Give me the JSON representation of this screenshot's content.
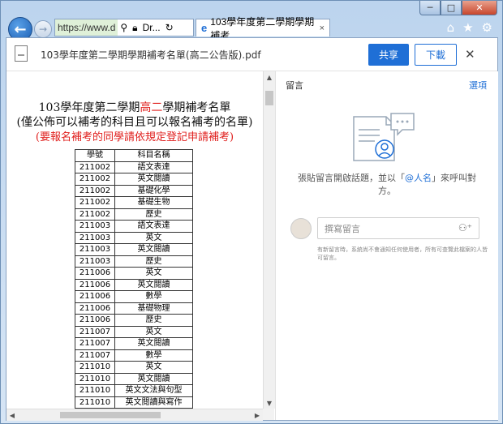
{
  "browser": {
    "address_url": "https://www.d",
    "address_search_icon": "search-icon",
    "address_tab2": "Dr...",
    "tab_title": "103學年度第二學期學期補考...",
    "tab_close": "×"
  },
  "window_controls": {
    "minimize": "─",
    "maximize": "□",
    "close": "✕"
  },
  "viewer": {
    "file_title": "103學年度第二學期學期補考名單(高二公告版).pdf",
    "share_label": "共享",
    "download_label": "下載",
    "close_label": "✕"
  },
  "document": {
    "title_prefix": "103學年度第二學期",
    "title_red": "高二",
    "title_suffix": "學期補考名單",
    "subtitle": "(僅公佈可以補考的科目且可以報名補考的名單)",
    "notice": "(要報名補考的同學請依規定登記申請補考)",
    "table_headers": [
      "學號",
      "科目名稱"
    ],
    "rows": [
      [
        "211002",
        "語文表達"
      ],
      [
        "211002",
        "英文閱讀"
      ],
      [
        "211002",
        "基礎化學"
      ],
      [
        "211002",
        "基礎生物"
      ],
      [
        "211002",
        "歷史"
      ],
      [
        "211003",
        "語文表達"
      ],
      [
        "211003",
        "英文"
      ],
      [
        "211003",
        "英文閱讀"
      ],
      [
        "211003",
        "歷史"
      ],
      [
        "211006",
        "英文"
      ],
      [
        "211006",
        "英文閱讀"
      ],
      [
        "211006",
        "數學"
      ],
      [
        "211006",
        "基礎物理"
      ],
      [
        "211006",
        "歷史"
      ],
      [
        "211007",
        "英文"
      ],
      [
        "211007",
        "英文閱讀"
      ],
      [
        "211007",
        "數學"
      ],
      [
        "211010",
        "英文"
      ],
      [
        "211010",
        "英文閱讀"
      ],
      [
        "211010",
        "英文文法與句型"
      ],
      [
        "211010",
        "英文閱讀與寫作"
      ]
    ]
  },
  "comments": {
    "title": "留言",
    "options": "選項",
    "hint_before": "張貼留言開啟話題，並以「",
    "hint_at": "@人名",
    "hint_after": "」來呼叫對方。",
    "input_placeholder": "撰寫留言",
    "note": "有新留言時，系統尚不會通知任何使用者，所有可查覽此檔案的人皆可留言。"
  }
}
